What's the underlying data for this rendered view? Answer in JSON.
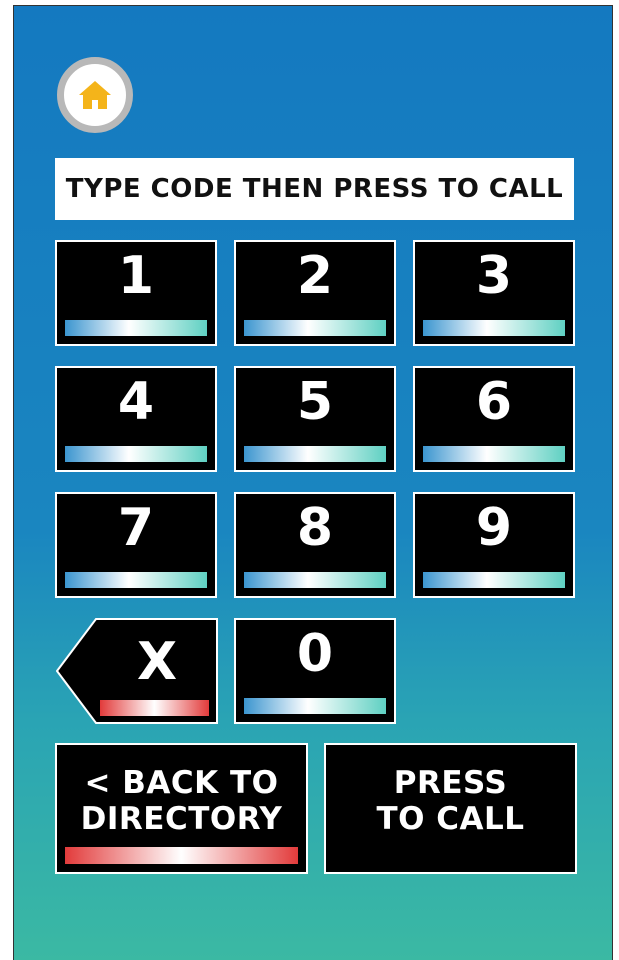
{
  "colors": {
    "background_top": "#1479c0",
    "background_bottom": "#3bb9a3",
    "key_background": "#000000",
    "home_icon": "#f4b41a"
  },
  "home": {
    "icon": "home-icon"
  },
  "instruction": "TYPE CODE THEN PRESS TO CALL",
  "keypad": {
    "k1": "1",
    "k2": "2",
    "k3": "3",
    "k4": "4",
    "k5": "5",
    "k6": "6",
    "k7": "7",
    "k8": "8",
    "k9": "9",
    "clear": "X",
    "k0": "0"
  },
  "actions": {
    "back": "< BACK TO\nDIRECTORY",
    "call": "PRESS\nTO CALL"
  }
}
